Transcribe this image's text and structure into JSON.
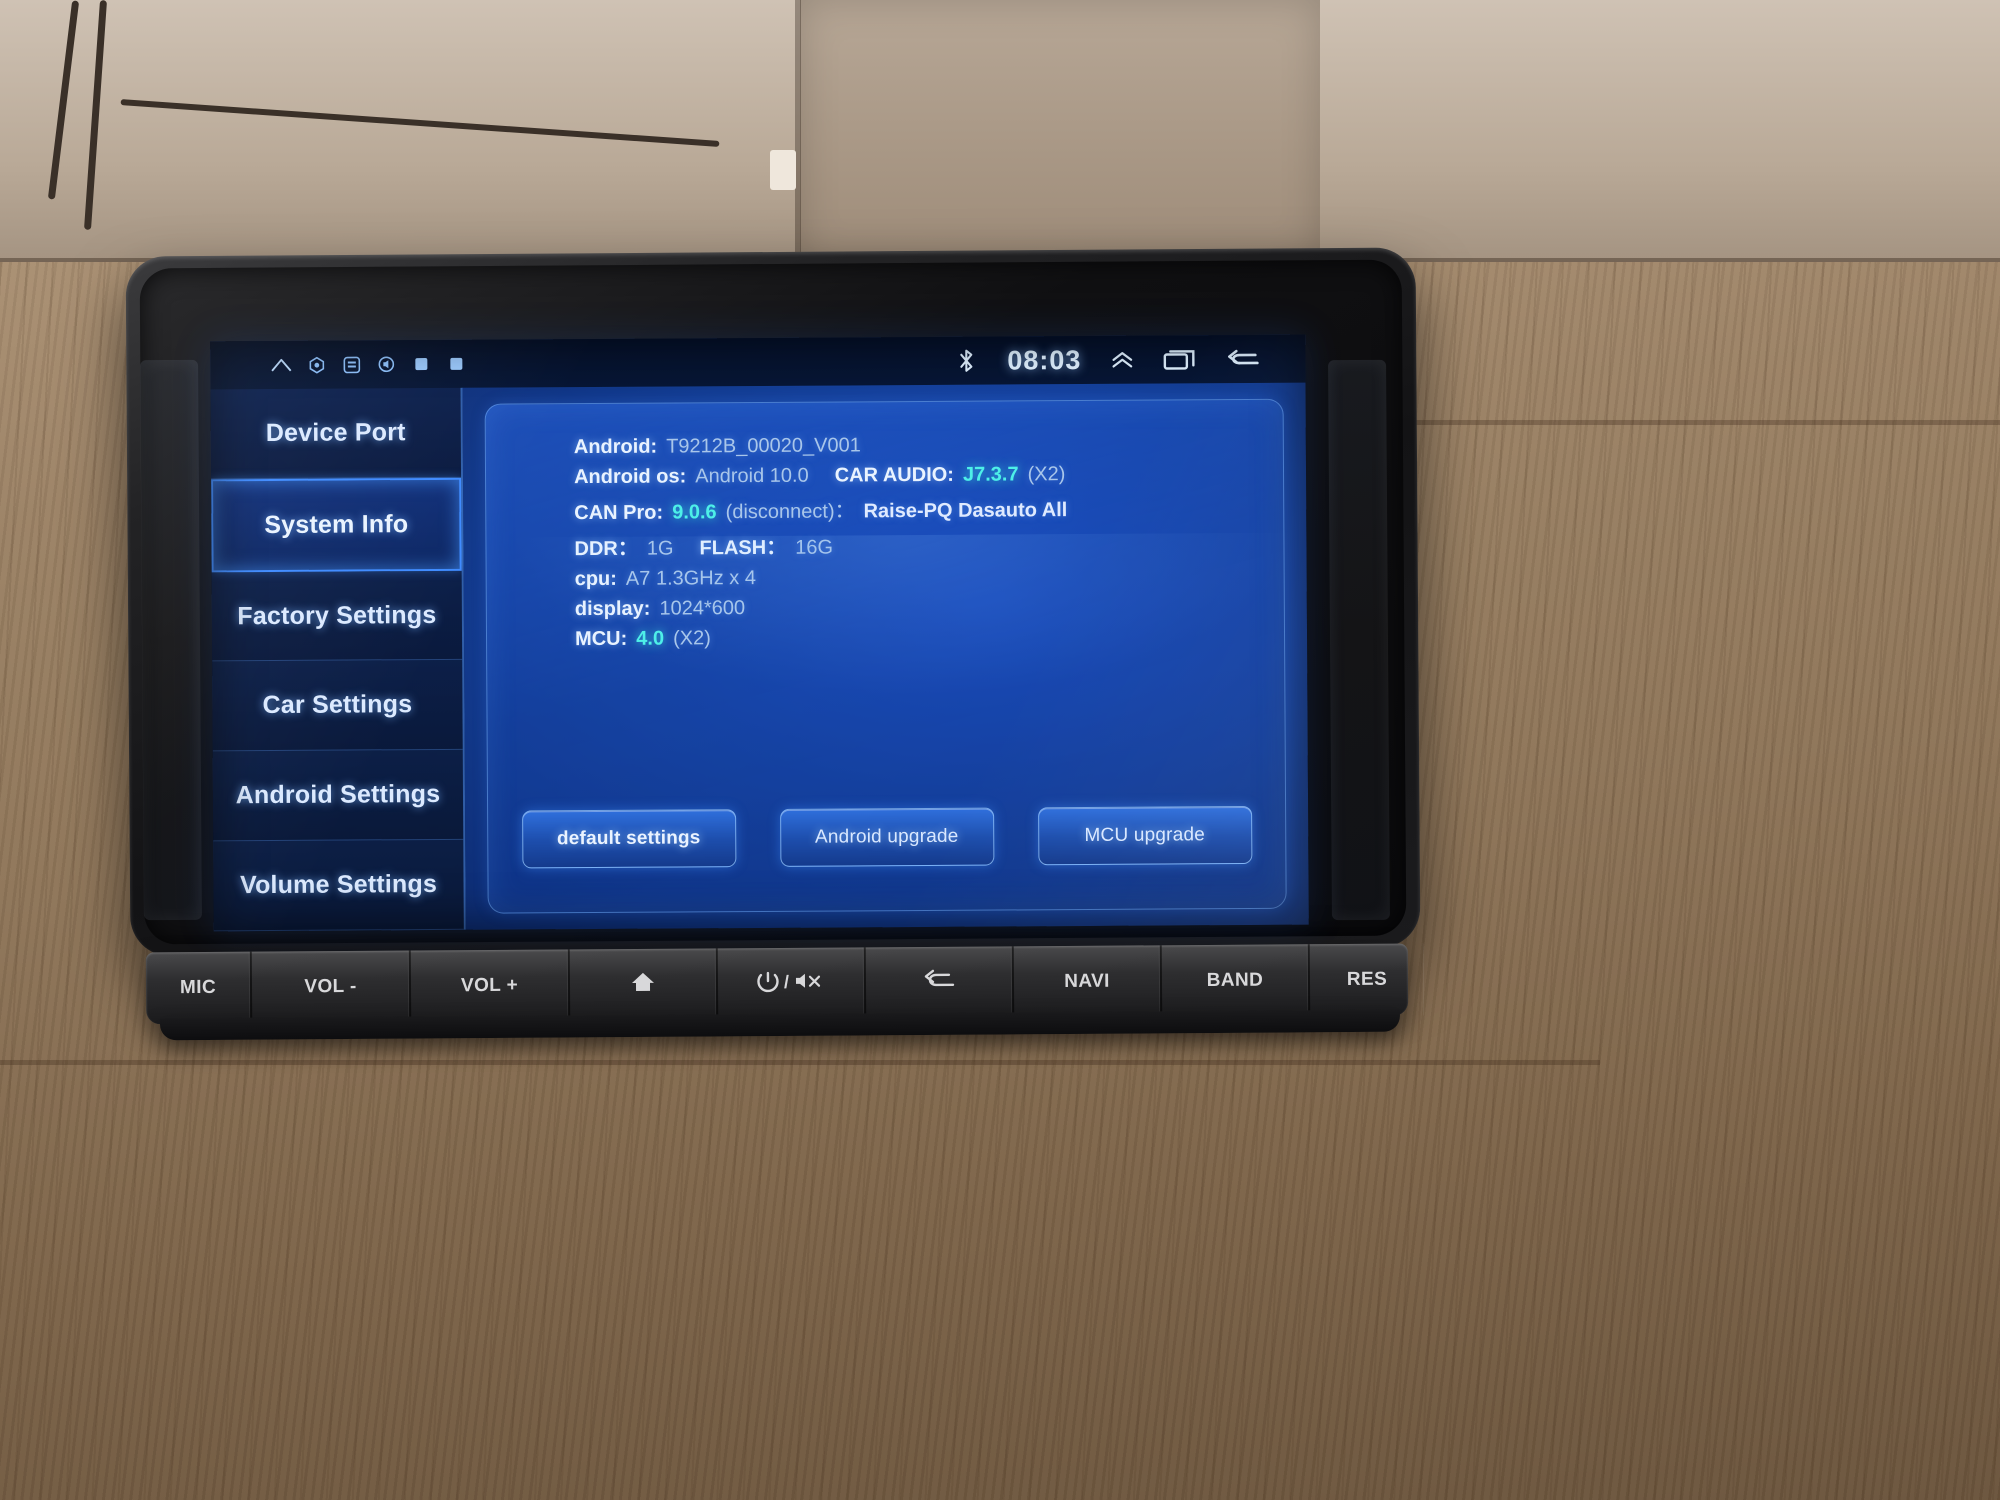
{
  "statusbar": {
    "left_icons": [
      "home-icon",
      "location-icon",
      "app-icon",
      "volume-icon",
      "square-icon",
      "square-icon"
    ],
    "bluetooth_icon": "bluetooth-icon",
    "clock": "08:03",
    "chevron_up_icon": "chevron-up-icon",
    "recents_icon": "recents-icon",
    "back_icon": "back-icon"
  },
  "sidebar": {
    "items": [
      {
        "label": "Device Port",
        "active": false
      },
      {
        "label": "System Info",
        "active": true
      },
      {
        "label": "Factory Settings",
        "active": false
      },
      {
        "label": "Car Settings",
        "active": false
      },
      {
        "label": "Android Settings",
        "active": false
      },
      {
        "label": "Volume Settings",
        "active": false
      }
    ]
  },
  "system_info": {
    "rows": [
      {
        "key": "Android:",
        "value": "T9212B_00020_V001"
      },
      {
        "key": "Android os:",
        "value": "Android 10.0",
        "key2": "CAR AUDIO:",
        "value2": "J7.3.7",
        "value2b": "(X2)"
      },
      {
        "key": "CAN Pro:",
        "value": "9.0.6",
        "value_note": "(disconnect)：",
        "value_tail": "Raise-PQ Dasauto All"
      },
      {
        "key": "DDR：",
        "value": "1G",
        "key2": "FLASH：",
        "value2": "16G"
      },
      {
        "key": "cpu:",
        "value": "A7 1.3GHz x 4"
      },
      {
        "key": "display:",
        "value": "1024*600"
      },
      {
        "key": "MCU:",
        "value": "4.0",
        "value2b": "(X2)"
      }
    ]
  },
  "actions": {
    "default_settings": "default settings",
    "android_upgrade": "Android upgrade",
    "mcu_upgrade": "MCU upgrade"
  },
  "hardware_buttons": [
    {
      "label": "MIC",
      "icon": ""
    },
    {
      "label": "VOL -",
      "icon": ""
    },
    {
      "label": "VOL +",
      "icon": ""
    },
    {
      "label": "",
      "icon": "home-icon"
    },
    {
      "label": "",
      "icon": "power-mute-icon"
    },
    {
      "label": "",
      "icon": "back-arrow-icon"
    },
    {
      "label": "NAVI",
      "icon": ""
    },
    {
      "label": "BAND",
      "icon": ""
    },
    {
      "label": "RES",
      "icon": ""
    }
  ],
  "colors": {
    "accent_cyan": "#4df0e8",
    "accent_blue": "#3f8bff",
    "screen_blue": "#154099",
    "text_light": "#e9f3ff"
  }
}
